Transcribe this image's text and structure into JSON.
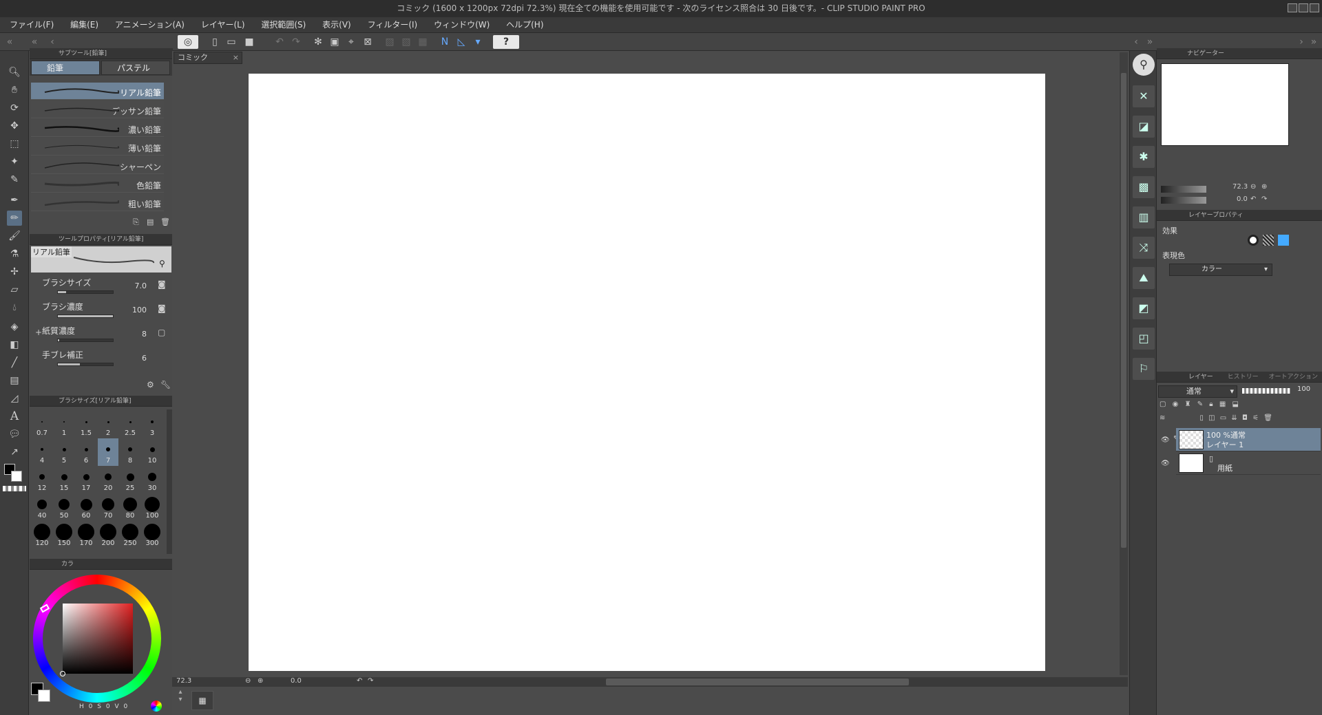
{
  "title": "コミック (1600 x 1200px 72dpi 72.3%)  現在全ての機能を使用可能です - 次のライセンス照合は 30 日後です。- CLIP STUDIO PAINT PRO",
  "menu": [
    "ファイル(F)",
    "編集(E)",
    "アニメーション(A)",
    "レイヤー(L)",
    "選択範囲(S)",
    "表示(V)",
    "フィルター(I)",
    "ウィンドウ(W)",
    "ヘルプ(H)"
  ],
  "subtool": {
    "header": "サブツール[鉛筆]",
    "tabs": [
      "鉛筆",
      "パステル"
    ],
    "brushes": [
      "リアル鉛筆",
      "デッサン鉛筆",
      "濃い鉛筆",
      "薄い鉛筆",
      "シャーペン",
      "色鉛筆",
      "粗い鉛筆"
    ]
  },
  "toolprop": {
    "header": "ツールプロパティ[リアル鉛筆]",
    "name": "リアル鉛筆",
    "props": [
      {
        "label": "ブラシサイズ",
        "value": "7.0",
        "fill": 0.15
      },
      {
        "label": "ブラシ濃度",
        "value": "100",
        "fill": 1.0
      },
      {
        "label": "紙質濃度",
        "value": "8",
        "fill": 0.02
      },
      {
        "label": "手ブレ補正",
        "value": "6",
        "fill": 0.4
      }
    ]
  },
  "brushsize": {
    "header": "ブラシサイズ[リアル鉛筆]",
    "sizes": [
      "0.7",
      "1",
      "1.5",
      "2",
      "2.5",
      "3",
      "4",
      "5",
      "6",
      "7",
      "8",
      "10",
      "12",
      "15",
      "17",
      "20",
      "25",
      "30",
      "40",
      "50",
      "60",
      "70",
      "80",
      "100",
      "120",
      "150",
      "170",
      "200",
      "250",
      "300"
    ],
    "selected": "7"
  },
  "color": {
    "tab": "カラ",
    "hsv_labels": [
      "H",
      "0",
      "S",
      "0",
      "V",
      "0"
    ],
    "main_color": "#000000",
    "sub_color": "#ffffff"
  },
  "document": {
    "tab": "コミック",
    "zoom": "72.3",
    "angle": "0.0"
  },
  "navigator": {
    "header": "ナビゲーター",
    "zoom": "72.3",
    "angle": "0.0"
  },
  "layerprop": {
    "header": "レイヤープロパティ",
    "effect_label": "効果",
    "color_label": "表現色",
    "color_value": "カラー"
  },
  "layers": {
    "tabs": [
      "レイヤー",
      "ヒストリー",
      "オートアクション"
    ],
    "blend": "通常",
    "opacity": "100",
    "items": [
      {
        "line1": "100 %通常",
        "line2": "レイヤー 1"
      },
      {
        "line1": "",
        "line2": "用紙"
      }
    ]
  }
}
